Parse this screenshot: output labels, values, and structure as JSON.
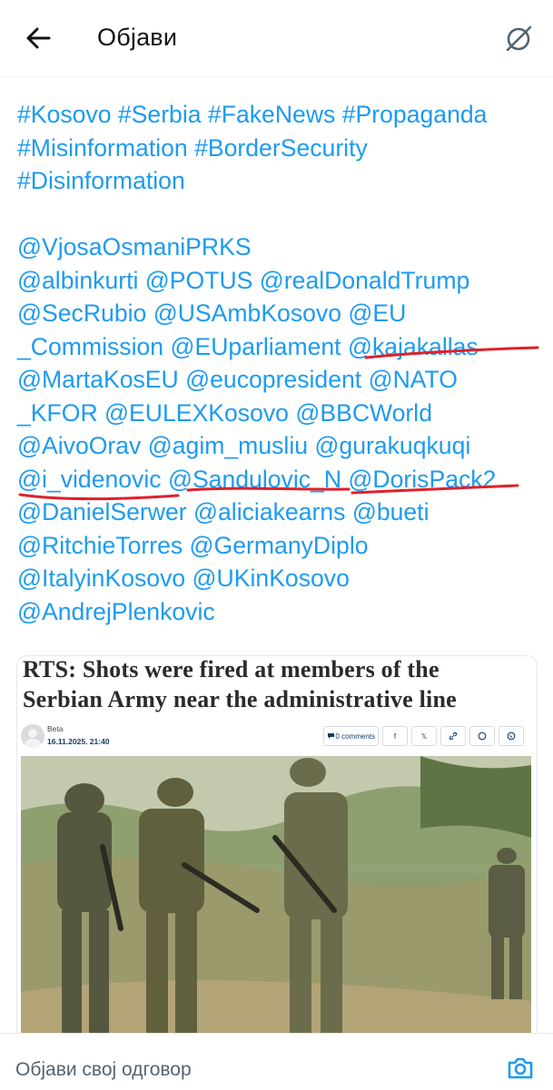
{
  "header": {
    "title": "Објави"
  },
  "post": {
    "lines": [
      "#Kosovo #Serbia #FakeNews #Propaganda",
      "#Misinformation #BorderSecurity",
      "#Disinformation",
      "",
      "@VjosaOsmaniPRKS",
      "@albinkurti @POTUS @realDonaldTrump",
      "@SecRubio @USAmbKosovo @EU",
      "_Commission @EUparliament @kajakallas",
      "@MartaKosEU @eucopresident @NATO",
      "_KFOR @EULEXKosovo @BBCWorld",
      "@AivoOrav @agim_musliu @gurakuqkuqi",
      "@i_videnovic @Sandulovic_N @DorisPack2",
      "@DanielSerwer @aliciakearns @bueti",
      "@RitchieTorres @GermanyDiplo",
      "@ItalyinKosovo @UKinKosovo",
      "@AndrejPlenkovic"
    ]
  },
  "card": {
    "headline_line1": "RTS: Shots were fired at members of the",
    "headline_line2": "Serbian Army near the administrative line",
    "author": "Beta",
    "date": "16.11.2025. 21:40",
    "comments": "0 comments",
    "share_icons": [
      "facebook-icon",
      "x-icon",
      "link-icon",
      "whatsapp-icon",
      "viber-icon"
    ]
  },
  "reply": {
    "placeholder": "Објави свој одговор"
  },
  "colors": {
    "link": "#1d9bf0",
    "underline": "#e0202a"
  }
}
